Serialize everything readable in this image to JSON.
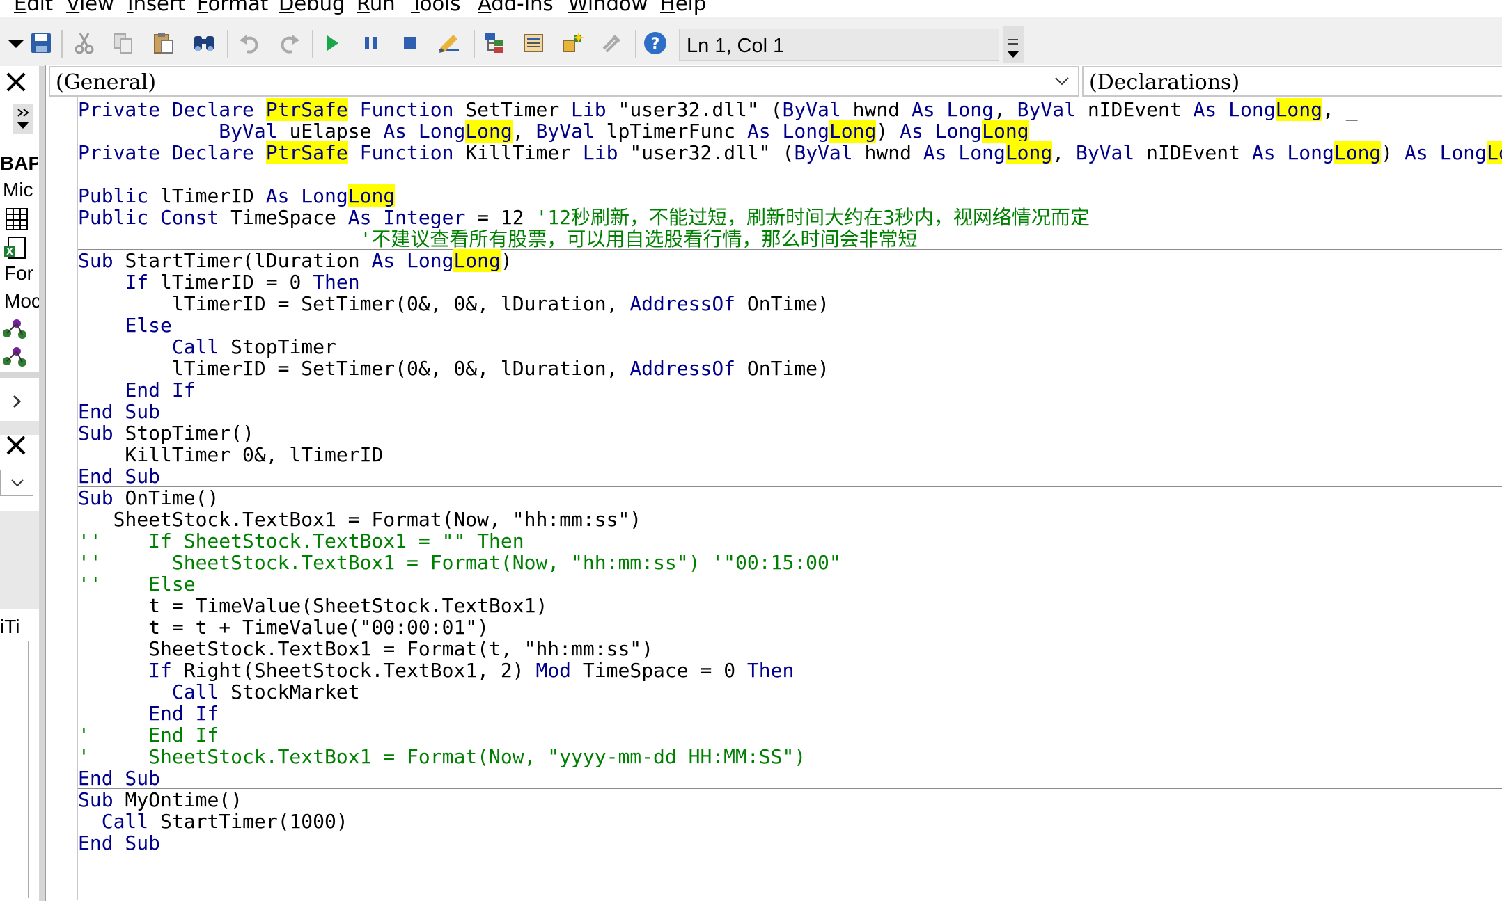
{
  "menu": [
    "Edit",
    "View",
    "Insert",
    "Format",
    "Debug",
    "Run",
    "Tools",
    "Add-Ins",
    "Window",
    "Help"
  ],
  "status": "Ln 1, Col 1",
  "combos": {
    "object": "(General)",
    "procedure": "(Declarations)"
  },
  "sidebar": [
    "BAP",
    "Mic",
    "For",
    "Moc",
    "iTi"
  ],
  "code": [
    [
      [
        "kw",
        "Private Declare "
      ],
      [
        "kw hl",
        "PtrSafe"
      ],
      [
        "kw",
        " Function "
      ],
      [
        "tx",
        "SetTimer "
      ],
      [
        "kw",
        "Lib "
      ],
      [
        "tx",
        "\"user32.dll\" ("
      ],
      [
        "kw",
        "ByVal "
      ],
      [
        "tx",
        "hwnd "
      ],
      [
        "kw",
        "As Long"
      ],
      [
        "tx",
        ", "
      ],
      [
        "kw",
        "ByVal "
      ],
      [
        "tx",
        "nIDEvent "
      ],
      [
        "kw",
        "As Long"
      ],
      [
        "kw hl",
        "Long"
      ],
      [
        "tx",
        ", "
      ],
      [
        "tx",
        "_"
      ]
    ],
    [
      [
        "tx",
        "            "
      ],
      [
        "kw",
        "ByVal "
      ],
      [
        "tx",
        "uElapse "
      ],
      [
        "kw",
        "As Long"
      ],
      [
        "kw hl",
        "Long"
      ],
      [
        "tx",
        ", "
      ],
      [
        "kw",
        "ByVal "
      ],
      [
        "tx",
        "lpTimerFunc "
      ],
      [
        "kw",
        "As Long"
      ],
      [
        "kw hl",
        "Long"
      ],
      [
        "tx",
        ") "
      ],
      [
        "kw",
        "As Long"
      ],
      [
        "kw hl",
        "Long"
      ]
    ],
    [
      [
        "kw",
        "Private Declare "
      ],
      [
        "kw hl",
        "PtrSafe"
      ],
      [
        "kw",
        " Function "
      ],
      [
        "tx",
        "KillTimer "
      ],
      [
        "kw",
        "Lib "
      ],
      [
        "tx",
        "\"user32.dll\" ("
      ],
      [
        "kw",
        "ByVal "
      ],
      [
        "tx",
        "hwnd "
      ],
      [
        "kw",
        "As Long"
      ],
      [
        "kw hl",
        "Long"
      ],
      [
        "tx",
        ", "
      ],
      [
        "kw",
        "ByVal "
      ],
      [
        "tx",
        "nIDEvent "
      ],
      [
        "kw",
        "As Long"
      ],
      [
        "kw hl",
        "Long"
      ],
      [
        "tx",
        ") "
      ],
      [
        "kw",
        "As Long"
      ],
      [
        "kw hl",
        "Long"
      ]
    ],
    [],
    [
      [
        "kw",
        "Public "
      ],
      [
        "tx",
        "lTimerID "
      ],
      [
        "kw",
        "As Long"
      ],
      [
        "kw hl",
        "Long"
      ]
    ],
    [
      [
        "kw",
        "Public Const "
      ],
      [
        "tx",
        "TimeSpace "
      ],
      [
        "kw",
        "As Integer "
      ],
      [
        "tx",
        "= 12 "
      ],
      [
        "cm",
        "'12秒刷新，不能过短，刷新时间大约在3秒内，视网络情况而定"
      ]
    ],
    [
      [
        "tx",
        "                        "
      ],
      [
        "cm",
        "'不建议查看所有股票，可以用自选股看行情，那么时间会非常短"
      ]
    ],
    [
      "SEP"
    ],
    [
      [
        "kw",
        "Sub "
      ],
      [
        "tx",
        "StartTimer(lDuration "
      ],
      [
        "kw",
        "As Long"
      ],
      [
        "kw hl",
        "Long"
      ],
      [
        "tx",
        ")"
      ]
    ],
    [
      [
        "tx",
        "    "
      ],
      [
        "kw",
        "If "
      ],
      [
        "tx",
        "lTimerID = 0 "
      ],
      [
        "kw",
        "Then"
      ]
    ],
    [
      [
        "tx",
        "        lTimerID = SetTimer(0&, 0&, lDuration, "
      ],
      [
        "kw",
        "AddressOf "
      ],
      [
        "tx",
        "OnTime)"
      ]
    ],
    [
      [
        "tx",
        "    "
      ],
      [
        "kw",
        "Else"
      ]
    ],
    [
      [
        "tx",
        "        "
      ],
      [
        "kw",
        "Call "
      ],
      [
        "tx",
        "StopTimer"
      ]
    ],
    [
      [
        "tx",
        "        lTimerID = SetTimer(0&, 0&, lDuration, "
      ],
      [
        "kw",
        "AddressOf "
      ],
      [
        "tx",
        "OnTime)"
      ]
    ],
    [
      [
        "tx",
        "    "
      ],
      [
        "kw",
        "End If"
      ]
    ],
    [
      [
        "kw",
        "End Sub"
      ]
    ],
    [
      "SEP"
    ],
    [
      [
        "kw",
        "Sub "
      ],
      [
        "tx",
        "StopTimer()"
      ]
    ],
    [
      [
        "tx",
        "    KillTimer 0&, lTimerID"
      ]
    ],
    [
      [
        "kw",
        "End Sub"
      ]
    ],
    [
      "SEP"
    ],
    [
      [
        "kw",
        "Sub "
      ],
      [
        "tx",
        "OnTime()"
      ]
    ],
    [
      [
        "tx",
        "   SheetStock.TextBox1 = Format(Now, \"hh:mm:ss\")"
      ]
    ],
    [
      [
        "cm",
        "''    If SheetStock.TextBox1 = \"\" Then"
      ]
    ],
    [
      [
        "cm",
        "''      SheetStock.TextBox1 = Format(Now, \"hh:mm:ss\") '\"00:15:00\""
      ]
    ],
    [
      [
        "cm",
        "''    Else"
      ]
    ],
    [
      [
        "tx",
        "      t = TimeValue(SheetStock.TextBox1)"
      ]
    ],
    [
      [
        "tx",
        "      t = t + TimeValue(\"00:00:01\")"
      ]
    ],
    [
      [
        "tx",
        "      SheetStock.TextBox1 = Format(t, \"hh:mm:ss\")"
      ]
    ],
    [
      [
        "tx",
        "      "
      ],
      [
        "kw",
        "If "
      ],
      [
        "tx",
        "Right(SheetStock.TextBox1, 2) "
      ],
      [
        "kw",
        "Mod "
      ],
      [
        "tx",
        "TimeSpace = 0 "
      ],
      [
        "kw",
        "Then"
      ]
    ],
    [
      [
        "tx",
        "        "
      ],
      [
        "kw",
        "Call "
      ],
      [
        "tx",
        "StockMarket"
      ]
    ],
    [
      [
        "tx",
        "      "
      ],
      [
        "kw",
        "End If"
      ]
    ],
    [
      [
        "cm",
        "'     End If"
      ]
    ],
    [
      [
        "cm",
        "'     SheetStock.TextBox1 = Format(Now, \"yyyy-mm-dd HH:MM:SS\")"
      ]
    ],
    [
      [
        "kw",
        "End Sub"
      ]
    ],
    [
      "SEP"
    ],
    [
      [
        "kw",
        "Sub "
      ],
      [
        "tx",
        "MyOntime()"
      ]
    ],
    [
      [
        "tx",
        "  "
      ],
      [
        "kw",
        "Call "
      ],
      [
        "tx",
        "StartTimer(1000)"
      ]
    ],
    [
      [
        "kw",
        "End Sub"
      ]
    ]
  ]
}
